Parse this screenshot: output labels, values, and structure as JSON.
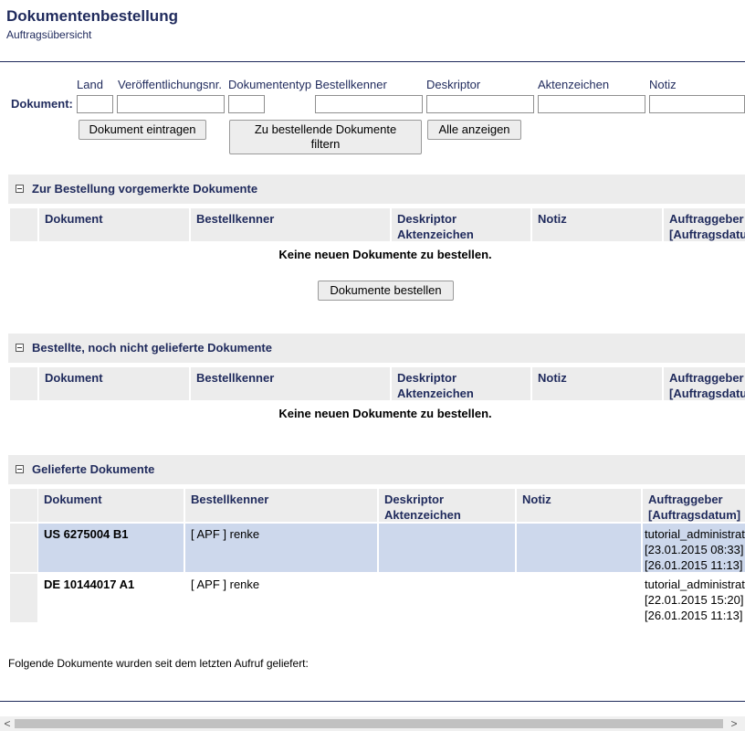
{
  "header": {
    "title": "Dokumentenbestellung",
    "subtitle": "Auftragsübersicht"
  },
  "form": {
    "row_label": "Dokument:",
    "labels": {
      "land": "Land",
      "veroeff": "Veröffentlichungsnr.",
      "typ": "Dokumententyp",
      "bestellkenner": "Bestellkenner",
      "deskriptor": "Deskriptor",
      "aktenzeichen": "Aktenzeichen",
      "notiz": "Notiz"
    },
    "values": {
      "land": "",
      "veroeff": "",
      "typ": "",
      "bestellkenner": "",
      "deskriptor": "",
      "aktenzeichen": "",
      "notiz": ""
    },
    "buttons": {
      "eintragen": "Dokument eintragen",
      "filtern_line1": "Zu bestellende Dokumente",
      "filtern_line2": "filtern",
      "alle": "Alle anzeigen"
    }
  },
  "columns": {
    "dokument": "Dokument",
    "bestellkenner": "Bestellkenner",
    "deskriptor": "Deskriptor",
    "aktenzeichen": "Aktenzeichen",
    "notiz": "Notiz",
    "auftraggeber": "Auftraggeber",
    "auftragsdatum": "[Auftragsdatum]"
  },
  "sections": {
    "vorgemerkt": {
      "title": "Zur Bestellung vorgemerkte Dokumente",
      "empty": "Keine neuen Dokumente zu bestellen.",
      "button": "Dokumente bestellen"
    },
    "bestellt": {
      "title": "Bestellte, noch nicht gelieferte Dokumente",
      "empty": "Keine neuen Dokumente zu bestellen."
    },
    "geliefert": {
      "title": "Gelieferte Dokumente",
      "rows": [
        {
          "dokument": "US 6275004 B1",
          "bestellkenner": "[ APF ] renke",
          "deskriptor": "",
          "notiz": "",
          "auftraggeber": "tutorial_administrat",
          "datum1": "[23.01.2015 08:33]",
          "datum2": "[26.01.2015 11:13]"
        },
        {
          "dokument": "DE 10144017 A1",
          "bestellkenner": "[ APF ] renke",
          "deskriptor": "",
          "notiz": "",
          "auftraggeber": "tutorial_administrat",
          "datum1": "[22.01.2015 15:20]",
          "datum2": "[26.01.2015 11:13]"
        }
      ]
    }
  },
  "footer": {
    "text": "Folgende Dokumente wurden seit dem letzten Aufruf geliefert:"
  },
  "scrollbar": {
    "left_arrow": "<",
    "right_arrow": ">"
  }
}
